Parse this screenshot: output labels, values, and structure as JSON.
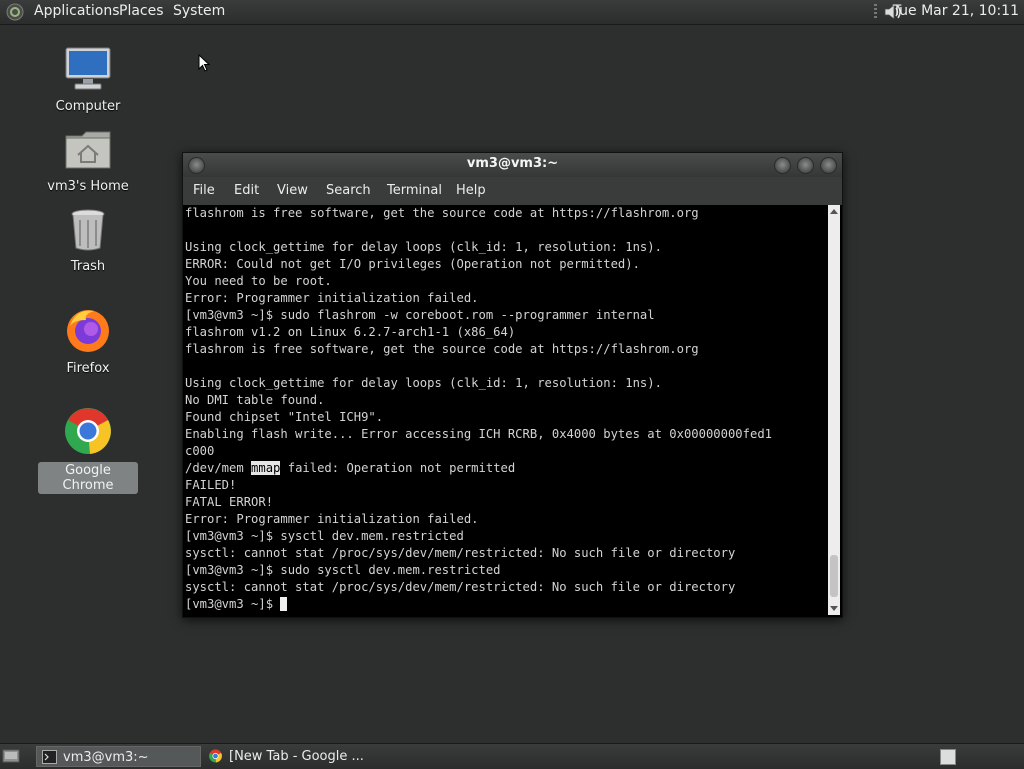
{
  "top_panel": {
    "menus": [
      "Applications",
      "Places",
      "System"
    ],
    "clock": "Tue Mar 21, 10:11",
    "icons": [
      "distro-logo-icon",
      "volume-icon"
    ]
  },
  "desktop": {
    "icons": [
      {
        "label": "Computer",
        "icon": "computer-icon"
      },
      {
        "label": "vm3's Home",
        "icon": "home-folder-icon"
      },
      {
        "label": "Trash",
        "icon": "trash-icon"
      },
      {
        "label": "Firefox",
        "icon": "firefox-icon"
      },
      {
        "label": "Google Chrome",
        "icon": "chrome-icon",
        "selected": true
      }
    ]
  },
  "terminal_window": {
    "title": "vm3@vm3:~",
    "menu": [
      "File",
      "Edit",
      "View",
      "Search",
      "Terminal",
      "Help"
    ],
    "lines": [
      "flashrom is free software, get the source code at https://flashrom.org",
      "",
      "Using clock_gettime for delay loops (clk_id: 1, resolution: 1ns).",
      "ERROR: Could not get I/O privileges (Operation not permitted).",
      "You need to be root.",
      "Error: Programmer initialization failed.",
      "[vm3@vm3 ~]$ sudo flashrom -w coreboot.rom --programmer internal",
      "flashrom v1.2 on Linux 6.2.7-arch1-1 (x86_64)",
      "flashrom is free software, get the source code at https://flashrom.org",
      "",
      "Using clock_gettime for delay loops (clk_id: 1, resolution: 1ns).",
      "No DMI table found.",
      "Found chipset \"Intel ICH9\".",
      "Enabling flash write... Error accessing ICH RCRB, 0x4000 bytes at 0x00000000fed1",
      "c000",
      "/dev/mem mmap failed: Operation not permitted",
      "FAILED!",
      "FATAL ERROR!",
      "Error: Programmer initialization failed.",
      "[vm3@vm3 ~]$ sysctl dev.mem.restricted",
      "sysctl: cannot stat /proc/sys/dev/mem/restricted: No such file or directory",
      "[vm3@vm3 ~]$ sudo sysctl dev.mem.restricted",
      "sysctl: cannot stat /proc/sys/dev/mem/restricted: No such file or directory"
    ],
    "highlight": {
      "line": 15,
      "prefix": "/dev/mem ",
      "word": "mmap",
      "suffix": " failed: Operation not permitted"
    },
    "prompt": "[vm3@vm3 ~]$ "
  },
  "bottom_panel": {
    "tasks": [
      {
        "label": "vm3@vm3:~",
        "icon": "terminal-icon",
        "active": true
      },
      {
        "label": "[New Tab - Google ...",
        "icon": "chrome-icon",
        "active": false
      }
    ]
  }
}
